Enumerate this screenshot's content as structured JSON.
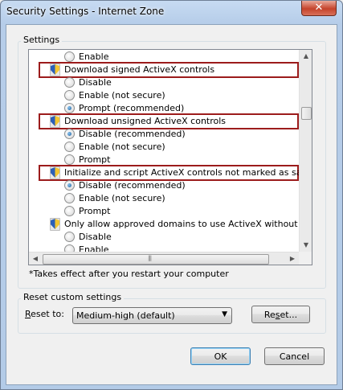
{
  "window": {
    "title": "Security Settings - Internet Zone",
    "close_glyph": "✕"
  },
  "settings_group": {
    "label": "Settings",
    "rows": [
      {
        "kind": "radio",
        "label": "Enable",
        "checked": false
      },
      {
        "kind": "header",
        "label": "Download signed ActiveX controls",
        "highlighted": true
      },
      {
        "kind": "radio",
        "label": "Disable",
        "checked": false
      },
      {
        "kind": "radio",
        "label": "Enable (not secure)",
        "checked": false
      },
      {
        "kind": "radio",
        "label": "Prompt (recommended)",
        "checked": true
      },
      {
        "kind": "header",
        "label": "Download unsigned ActiveX controls",
        "highlighted": true
      },
      {
        "kind": "radio",
        "label": "Disable (recommended)",
        "checked": true
      },
      {
        "kind": "radio",
        "label": "Enable (not secure)",
        "checked": false
      },
      {
        "kind": "radio",
        "label": "Prompt",
        "checked": false
      },
      {
        "kind": "header",
        "label": "Initialize and script ActiveX controls not marked as safe for sc",
        "highlighted": true
      },
      {
        "kind": "radio",
        "label": "Disable (recommended)",
        "checked": true
      },
      {
        "kind": "radio",
        "label": "Enable (not secure)",
        "checked": false
      },
      {
        "kind": "radio",
        "label": "Prompt",
        "checked": false
      },
      {
        "kind": "header",
        "label": "Only allow approved domains to use ActiveX without prompt",
        "highlighted": false
      },
      {
        "kind": "radio",
        "label": "Disable",
        "checked": false
      },
      {
        "kind": "radio",
        "label": "Enable",
        "checked": false
      }
    ],
    "note": "*Takes effect after you restart your computer"
  },
  "reset_group": {
    "label": "Reset custom settings",
    "reset_to_label": "Reset to:",
    "selected_level": "Medium-high (default)",
    "reset_button": "Reset..."
  },
  "footer": {
    "ok_label": "OK",
    "cancel_label": "Cancel"
  },
  "colors": {
    "highlight_border": "#9c1c1c",
    "listbox_background": "#ffffff"
  }
}
